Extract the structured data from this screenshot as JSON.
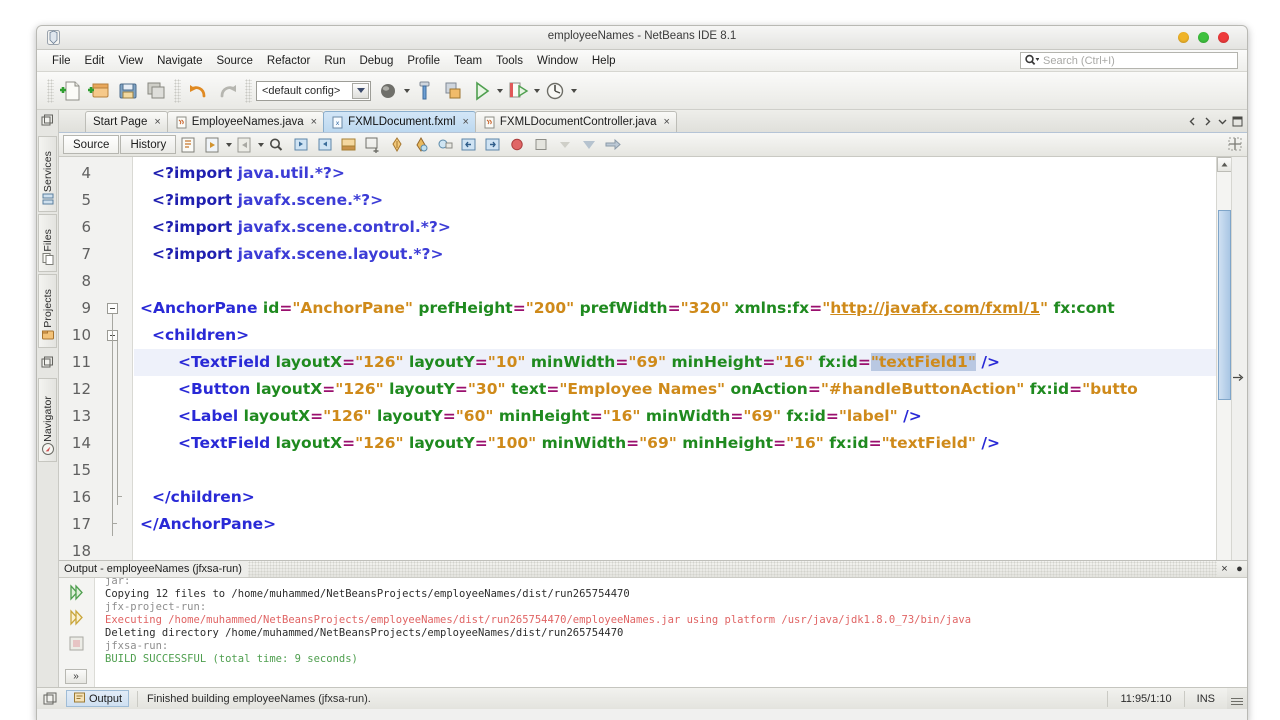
{
  "window": {
    "title": "employeeNames - NetBeans IDE 8.1",
    "app_icon": "netbeans-icon",
    "controls": {
      "minimize": "minimize-button",
      "maximize": "maximize-button",
      "close": "close-button"
    }
  },
  "menubar": {
    "items": [
      {
        "label": "File"
      },
      {
        "label": "Edit"
      },
      {
        "label": "View"
      },
      {
        "label": "Navigate"
      },
      {
        "label": "Source"
      },
      {
        "label": "Refactor"
      },
      {
        "label": "Run"
      },
      {
        "label": "Debug"
      },
      {
        "label": "Profile"
      },
      {
        "label": "Team"
      },
      {
        "label": "Tools"
      },
      {
        "label": "Window"
      },
      {
        "label": "Help"
      }
    ],
    "search": {
      "placeholder": "Search (Ctrl+I)",
      "value": ""
    }
  },
  "toolbar": {
    "config_value": "<default config>",
    "buttons": [
      {
        "name": "new-file-button"
      },
      {
        "name": "new-project-button"
      },
      {
        "name": "open-project-button"
      },
      {
        "name": "save-all-button"
      },
      {
        "name": "undo-button"
      },
      {
        "name": "redo-button"
      },
      {
        "name": "build-project-button"
      },
      {
        "name": "clean-build-button"
      },
      {
        "name": "clean-build-alt-button"
      },
      {
        "name": "run-project-button"
      },
      {
        "name": "debug-project-button"
      },
      {
        "name": "profile-project-button"
      }
    ]
  },
  "leftstrip": {
    "tabs": [
      {
        "label": "Services",
        "icon": "services-icon"
      },
      {
        "label": "Files",
        "icon": "files-icon"
      },
      {
        "label": "Projects",
        "icon": "projects-icon"
      },
      {
        "label": "Navigator",
        "icon": "navigator-icon"
      }
    ]
  },
  "editor_tabs": {
    "tabs": [
      {
        "label": "Start Page",
        "icon": null,
        "active": false,
        "close": "×"
      },
      {
        "label": "EmployeeNames.java",
        "icon": "java-file-icon",
        "active": false,
        "close": "×"
      },
      {
        "label": "FXMLDocument.fxml",
        "icon": "fxml-file-icon",
        "active": true,
        "close": "×"
      },
      {
        "label": "FXMLDocumentController.java",
        "icon": "java-file-icon",
        "active": false,
        "close": "×"
      }
    ]
  },
  "editor_toolbar": {
    "source_label": "Source",
    "history_label": "History",
    "icons": [
      "last-edit-icon",
      "back-icon",
      "forward-icon",
      "find-selection-icon",
      "previous-bookmark-icon",
      "next-bookmark-icon",
      "toggle-bookmark-icon",
      "shift-left-icon",
      "shift-right-icon",
      "start-macro-icon",
      "stop-macro-icon",
      "comment-icon",
      "uncomment-icon",
      "toggle-breakpoint-icon",
      "stop-icon",
      "previous-error-icon",
      "next-error-icon",
      "next-bookmark-arrow-icon"
    ]
  },
  "code": {
    "first_line_number": 4,
    "lines": [
      {
        "num": 4,
        "indent": 1,
        "tokens": [
          {
            "t": "pi",
            "v": "<?import "
          },
          {
            "t": "pkg",
            "v": "java.util.*?>"
          }
        ]
      },
      {
        "num": 5,
        "indent": 1,
        "tokens": [
          {
            "t": "pi",
            "v": "<?import "
          },
          {
            "t": "pkg",
            "v": "javafx.scene.*?>"
          }
        ]
      },
      {
        "num": 6,
        "indent": 1,
        "tokens": [
          {
            "t": "pi",
            "v": "<?import "
          },
          {
            "t": "pkg",
            "v": "javafx.scene.control.*?>"
          }
        ]
      },
      {
        "num": 7,
        "indent": 1,
        "tokens": [
          {
            "t": "pi",
            "v": "<?import "
          },
          {
            "t": "pkg",
            "v": "javafx.scene.layout.*?>"
          }
        ]
      },
      {
        "num": 8,
        "indent": 0,
        "tokens": []
      },
      {
        "num": 9,
        "indent": 0,
        "tokens": [
          {
            "t": "tagname",
            "v": "<AnchorPane "
          },
          {
            "t": "attr",
            "v": "id"
          },
          {
            "t": "eq",
            "v": "="
          },
          {
            "t": "val",
            "v": "\"AnchorPane\""
          },
          {
            "t": "plain",
            "v": " "
          },
          {
            "t": "attr",
            "v": "prefHeight"
          },
          {
            "t": "eq",
            "v": "="
          },
          {
            "t": "val",
            "v": "\"200\""
          },
          {
            "t": "plain",
            "v": " "
          },
          {
            "t": "attr",
            "v": "prefWidth"
          },
          {
            "t": "eq",
            "v": "="
          },
          {
            "t": "val",
            "v": "\"320\""
          },
          {
            "t": "plain",
            "v": " "
          },
          {
            "t": "attr",
            "v": "xmlns:fx"
          },
          {
            "t": "eq",
            "v": "="
          },
          {
            "t": "val",
            "v": "\""
          },
          {
            "t": "link",
            "v": "http://javafx.com/fxml/1"
          },
          {
            "t": "val",
            "v": "\""
          },
          {
            "t": "plain",
            "v": " "
          },
          {
            "t": "attr",
            "v": "fx:cont"
          }
        ]
      },
      {
        "num": 10,
        "indent": 1,
        "tokens": [
          {
            "t": "tagname",
            "v": "<children>"
          }
        ]
      },
      {
        "num": 11,
        "indent": 2,
        "highlight": true,
        "tokens": [
          {
            "t": "tagname",
            "v": "<TextField "
          },
          {
            "t": "attr",
            "v": "layoutX"
          },
          {
            "t": "eq",
            "v": "="
          },
          {
            "t": "val",
            "v": "\"126\""
          },
          {
            "t": "plain",
            "v": " "
          },
          {
            "t": "attr",
            "v": "layoutY"
          },
          {
            "t": "eq",
            "v": "="
          },
          {
            "t": "val",
            "v": "\"10\""
          },
          {
            "t": "plain",
            "v": " "
          },
          {
            "t": "attr",
            "v": "minWidth"
          },
          {
            "t": "eq",
            "v": "="
          },
          {
            "t": "val",
            "v": "\"69\""
          },
          {
            "t": "plain",
            "v": " "
          },
          {
            "t": "attr",
            "v": "minHeight"
          },
          {
            "t": "eq",
            "v": "="
          },
          {
            "t": "val",
            "v": "\"16\""
          },
          {
            "t": "plain",
            "v": " "
          },
          {
            "t": "attr",
            "v": "fx:id"
          },
          {
            "t": "eq",
            "v": "="
          },
          {
            "t": "val-sel",
            "v": "\"textField1\""
          },
          {
            "t": "plain",
            "v": " "
          },
          {
            "t": "tagname",
            "v": "/>"
          }
        ]
      },
      {
        "num": 12,
        "indent": 2,
        "tokens": [
          {
            "t": "tagname",
            "v": "<Button "
          },
          {
            "t": "attr",
            "v": "layoutX"
          },
          {
            "t": "eq",
            "v": "="
          },
          {
            "t": "val",
            "v": "\"126\""
          },
          {
            "t": "plain",
            "v": " "
          },
          {
            "t": "attr",
            "v": "layoutY"
          },
          {
            "t": "eq",
            "v": "="
          },
          {
            "t": "val",
            "v": "\"30\""
          },
          {
            "t": "plain",
            "v": " "
          },
          {
            "t": "attr",
            "v": "text"
          },
          {
            "t": "eq",
            "v": "="
          },
          {
            "t": "val",
            "v": "\"Employee Names\""
          },
          {
            "t": "plain",
            "v": " "
          },
          {
            "t": "attr",
            "v": "onAction"
          },
          {
            "t": "eq",
            "v": "="
          },
          {
            "t": "val",
            "v": "\"#handleButtonAction\""
          },
          {
            "t": "plain",
            "v": " "
          },
          {
            "t": "attr",
            "v": "fx:id"
          },
          {
            "t": "eq",
            "v": "="
          },
          {
            "t": "val",
            "v": "\"butto"
          }
        ]
      },
      {
        "num": 13,
        "indent": 2,
        "tokens": [
          {
            "t": "tagname",
            "v": "<Label "
          },
          {
            "t": "attr",
            "v": "layoutX"
          },
          {
            "t": "eq",
            "v": "="
          },
          {
            "t": "val",
            "v": "\"126\""
          },
          {
            "t": "plain",
            "v": " "
          },
          {
            "t": "attr",
            "v": "layoutY"
          },
          {
            "t": "eq",
            "v": "="
          },
          {
            "t": "val",
            "v": "\"60\""
          },
          {
            "t": "plain",
            "v": " "
          },
          {
            "t": "attr",
            "v": "minHeight"
          },
          {
            "t": "eq",
            "v": "="
          },
          {
            "t": "val",
            "v": "\"16\""
          },
          {
            "t": "plain",
            "v": " "
          },
          {
            "t": "attr",
            "v": "minWidth"
          },
          {
            "t": "eq",
            "v": "="
          },
          {
            "t": "val",
            "v": "\"69\""
          },
          {
            "t": "plain",
            "v": " "
          },
          {
            "t": "attr",
            "v": "fx:id"
          },
          {
            "t": "eq",
            "v": "="
          },
          {
            "t": "val",
            "v": "\"label\""
          },
          {
            "t": "plain",
            "v": " "
          },
          {
            "t": "tagname",
            "v": "/>"
          }
        ]
      },
      {
        "num": 14,
        "indent": 2,
        "tokens": [
          {
            "t": "tagname",
            "v": "<TextField "
          },
          {
            "t": "attr",
            "v": "layoutX"
          },
          {
            "t": "eq",
            "v": "="
          },
          {
            "t": "val",
            "v": "\"126\""
          },
          {
            "t": "plain",
            "v": " "
          },
          {
            "t": "attr",
            "v": "layoutY"
          },
          {
            "t": "eq",
            "v": "="
          },
          {
            "t": "val",
            "v": "\"100\""
          },
          {
            "t": "plain",
            "v": " "
          },
          {
            "t": "attr",
            "v": "minWidth"
          },
          {
            "t": "eq",
            "v": "="
          },
          {
            "t": "val",
            "v": "\"69\""
          },
          {
            "t": "plain",
            "v": " "
          },
          {
            "t": "attr",
            "v": "minHeight"
          },
          {
            "t": "eq",
            "v": "="
          },
          {
            "t": "val",
            "v": "\"16\""
          },
          {
            "t": "plain",
            "v": " "
          },
          {
            "t": "attr",
            "v": "fx:id"
          },
          {
            "t": "eq",
            "v": "="
          },
          {
            "t": "val",
            "v": "\"textField\""
          },
          {
            "t": "plain",
            "v": " "
          },
          {
            "t": "tagname",
            "v": "/>"
          }
        ]
      },
      {
        "num": 15,
        "indent": 0,
        "tokens": []
      },
      {
        "num": 16,
        "indent": 1,
        "tokens": [
          {
            "t": "tagname",
            "v": "</children>"
          }
        ]
      },
      {
        "num": 17,
        "indent": 0,
        "tokens": [
          {
            "t": "tagname",
            "v": "</AnchorPane>"
          }
        ]
      },
      {
        "num": 18,
        "indent": 0,
        "tokens": []
      }
    ]
  },
  "output": {
    "title": "Output - employeeNames (jfxsa-run)",
    "close_label": "×",
    "pin_label": "●",
    "more_label": "»",
    "lines": [
      {
        "text": "jar:",
        "style": "gray"
      },
      {
        "text": "Copying 12 files to /home/muhammed/NetBeansProjects/employeeNames/dist/run265754470",
        "style": "dark"
      },
      {
        "text": "jfx-project-run:",
        "style": "gray"
      },
      {
        "text": "Executing /home/muhammed/NetBeansProjects/employeeNames/dist/run265754470/employeeNames.jar using platform /usr/java/jdk1.8.0_73/bin/java",
        "style": "red"
      },
      {
        "text": "Deleting directory /home/muhammed/NetBeansProjects/employeeNames/dist/run265754470",
        "style": "dark"
      },
      {
        "text": "jfxsa-run:",
        "style": "gray"
      },
      {
        "text": "BUILD SUCCESSFUL (total time: 9 seconds)",
        "style": "green"
      }
    ]
  },
  "statusbar": {
    "output_button": "Output",
    "message": "Finished building employeeNames (jfxsa-run).",
    "position": "11:95/1:10",
    "insert_mode": "INS"
  }
}
